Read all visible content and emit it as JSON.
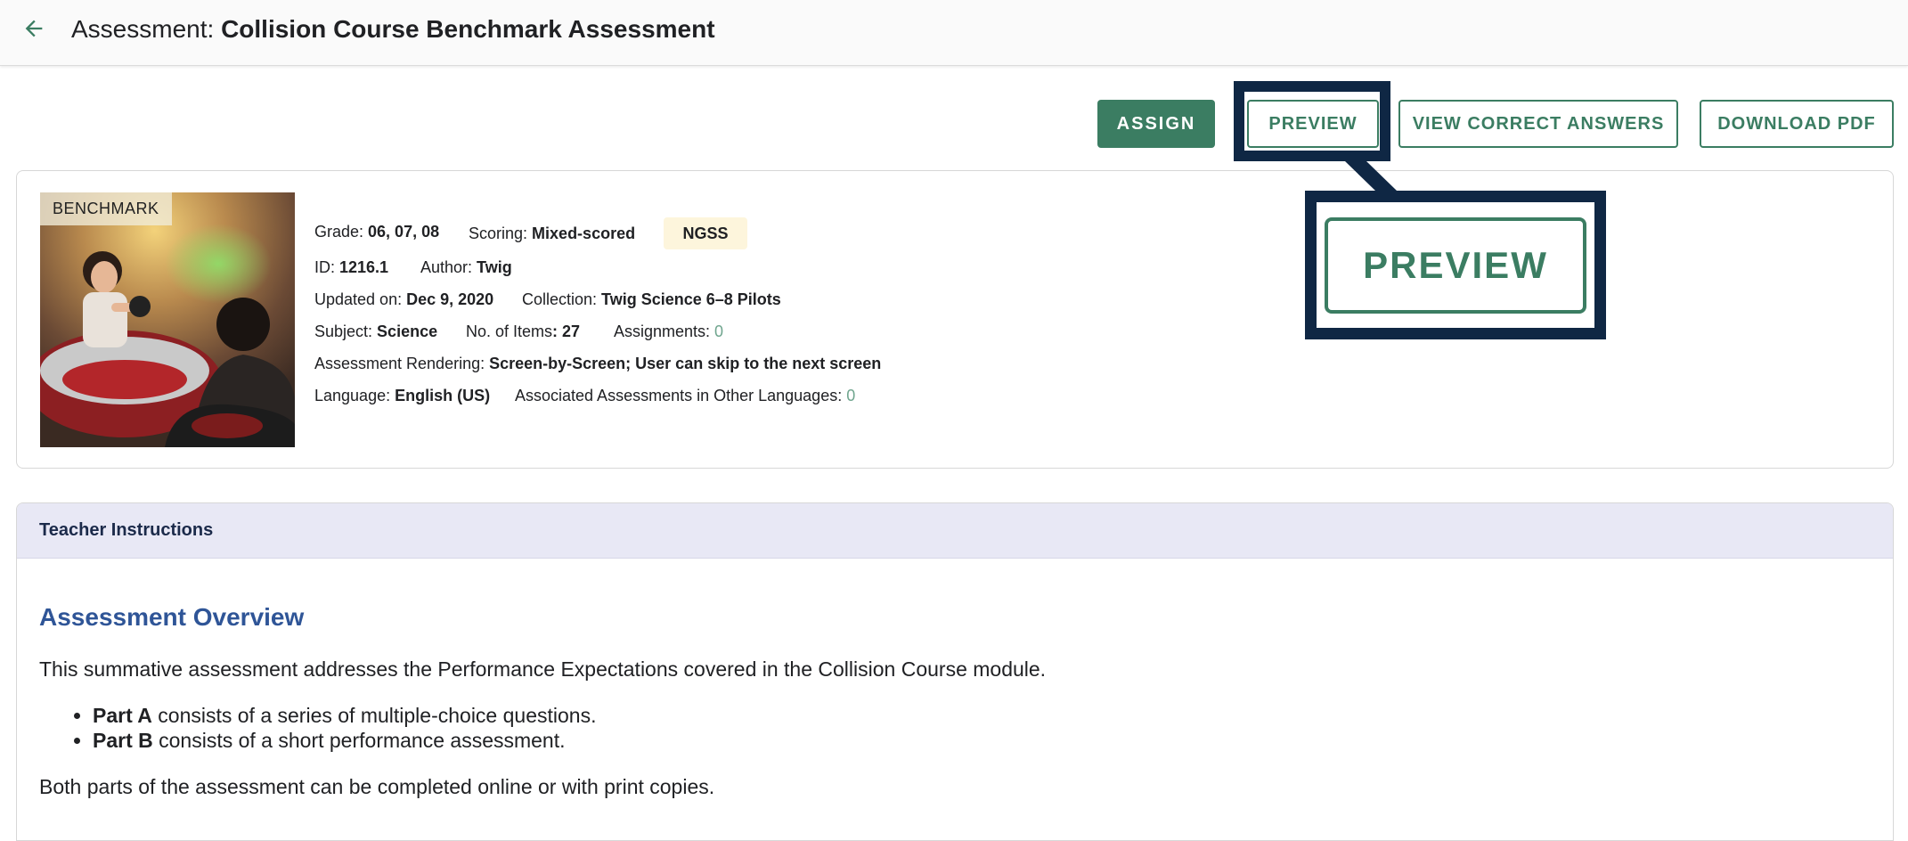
{
  "header": {
    "title_prefix": "Assessment: ",
    "title_name": "Collision Course Benchmark Assessment"
  },
  "actions": {
    "assign": "ASSIGN",
    "preview": "PREVIEW",
    "view_correct_answers": "VIEW CORRECT ANSWERS",
    "download_pdf": "DOWNLOAD PDF"
  },
  "callout": {
    "zoom_label": "PREVIEW"
  },
  "details": {
    "thumbnail_tag": "BENCHMARK",
    "grade_label": "Grade: ",
    "grade_value": "06, 07, 08",
    "scoring_label": "Scoring: ",
    "scoring_value": "Mixed-scored",
    "standard_badge": "NGSS",
    "id_label": "ID: ",
    "id_value": "1216.1",
    "author_label": "Author: ",
    "author_value": "Twig",
    "updated_label": "Updated on: ",
    "updated_value": "Dec 9, 2020",
    "collection_label": "Collection: ",
    "collection_value": "Twig Science 6–8 Pilots",
    "subject_label": "Subject: ",
    "subject_value": "Science",
    "items_label": "No. of Items",
    "items_value": ": 27",
    "assignments_label": "Assignments: ",
    "assignments_value": "0",
    "rendering_label": "Assessment Rendering: ",
    "rendering_value": "Screen-by-Screen; User can skip to the next screen",
    "language_label": "Language: ",
    "language_value": "English (US)",
    "associated_label": "Associated Assessments in Other Languages: ",
    "associated_value": "0"
  },
  "instructions": {
    "header": "Teacher Instructions",
    "overview_title": "Assessment Overview",
    "intro": "This summative assessment addresses the Performance Expectations covered in the Collision Course module.",
    "parts": [
      {
        "name": "Part A",
        "text": " consists of a series of multiple-choice questions."
      },
      {
        "name": "Part B",
        "text": " consists of a short performance assessment."
      }
    ],
    "closing": "Both parts of the assessment can be completed online or with print copies."
  },
  "colors": {
    "accent_green": "#3b7d62",
    "callout_navy": "#0f2744",
    "overview_blue": "#2f5597",
    "instructions_header_bg": "#e8e8f5"
  }
}
